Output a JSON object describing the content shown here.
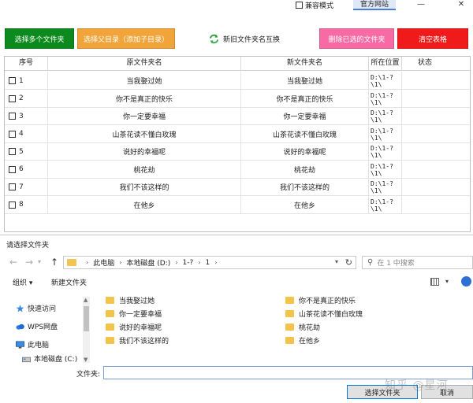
{
  "window": {
    "compat_label": "兼容模式",
    "site_tab": "官方网站",
    "minimize": "—",
    "close": "✕"
  },
  "toolbar": {
    "select_folders": "选择多个文件夹",
    "select_parent": "选择父目录（添加子目录）",
    "swap": "新旧文件夹名互换",
    "delete_selected": "删除已选的文件夹",
    "clear_table": "清空表格",
    "colors": {
      "select_folders": "#0c8a1e",
      "select_parent": "#f0a43a",
      "delete_selected": "#f76aa3",
      "clear_table": "#f01a1a"
    }
  },
  "table": {
    "headers": [
      "序号",
      "原文件夹名",
      "新文件夹名",
      "所在位置",
      "状态"
    ],
    "rows": [
      {
        "idx": "1",
        "old": "当我娶过她",
        "new": "当我娶过她",
        "loc": "D:\\1-?\n\\1\\",
        "status": ""
      },
      {
        "idx": "2",
        "old": "你不是真正的快乐",
        "new": "你不是真正的快乐",
        "loc": "D:\\1-?\n\\1\\",
        "status": ""
      },
      {
        "idx": "3",
        "old": "你一定要幸福",
        "new": "你一定要幸福",
        "loc": "D:\\1-?\n\\1\\",
        "status": ""
      },
      {
        "idx": "4",
        "old": "山茶花读不懂白玫瑰",
        "new": "山茶花读不懂白玫瑰",
        "loc": "D:\\1-?\n\\1\\",
        "status": ""
      },
      {
        "idx": "5",
        "old": "说好的幸福呢",
        "new": "说好的幸福呢",
        "loc": "D:\\1-?\n\\1\\",
        "status": ""
      },
      {
        "idx": "6",
        "old": "桃花劫",
        "new": "桃花劫",
        "loc": "D:\\1-?\n\\1\\",
        "status": ""
      },
      {
        "idx": "7",
        "old": "我们不该这样的",
        "new": "我们不该这样的",
        "loc": "D:\\1-?\n\\1\\",
        "status": ""
      },
      {
        "idx": "8",
        "old": "在他乡",
        "new": "在他乡",
        "loc": "D:\\1-?\n\\1\\",
        "status": ""
      }
    ]
  },
  "dialog": {
    "title": "请选择文件夹",
    "path": [
      "此电脑",
      "本地磁盘 (D:)",
      "1-?",
      "1"
    ],
    "search_placeholder": "在 1 中搜索",
    "organize": "组织 ▾",
    "new_folder": "新建文件夹",
    "sidebar": [
      {
        "label": "快速访问",
        "icon": "star-icon"
      },
      {
        "label": "WPS网盘",
        "icon": "cloud-icon"
      },
      {
        "label": "此电脑",
        "icon": "computer-icon"
      },
      {
        "label": "本地磁盘 (C:)",
        "icon": "drive-icon"
      }
    ],
    "folders_left": [
      "当我娶过她",
      "你一定要幸福",
      "说好的幸福呢",
      "我们不该这样的"
    ],
    "folders_right": [
      "你不是真正的快乐",
      "山茶花读不懂白玫瑰",
      "桃花劫",
      "在他乡"
    ],
    "folder_label": "文件夹:",
    "folder_value": "",
    "select_button": "选择文件夹",
    "cancel_button": "取消"
  },
  "watermark": "知乎 @星河"
}
